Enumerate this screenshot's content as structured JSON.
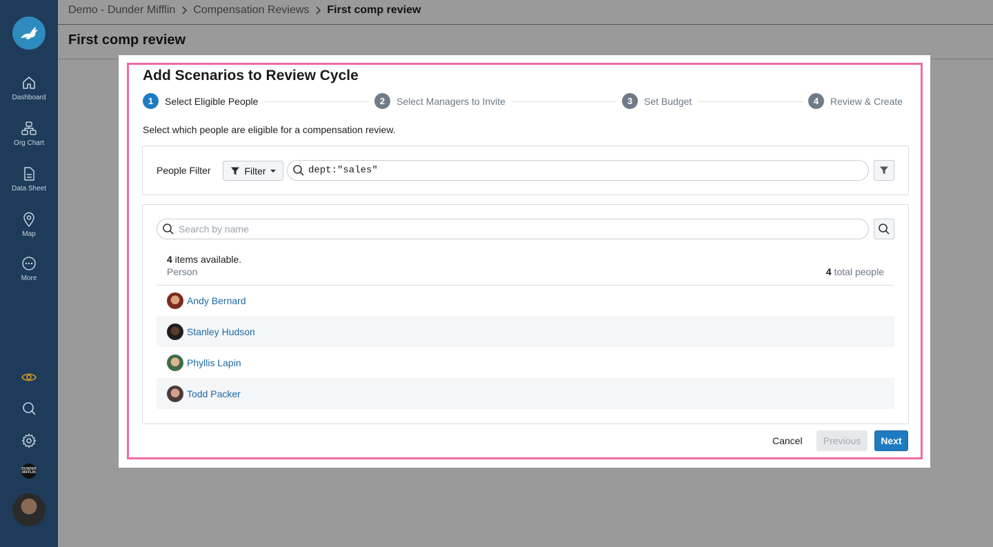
{
  "sidebar": {
    "items": [
      {
        "label": "Dashboard",
        "icon": "home-icon"
      },
      {
        "label": "Org Chart",
        "icon": "org-chart-icon"
      },
      {
        "label": "Data Sheet",
        "icon": "document-icon"
      },
      {
        "label": "Map",
        "icon": "map-pin-icon"
      },
      {
        "label": "More",
        "icon": "more-icon"
      }
    ],
    "bottom_icons": [
      "eye-icon",
      "search-icon",
      "gear-icon"
    ],
    "company_logo_text": "DUNDER MIFFLIN"
  },
  "breadcrumb": {
    "items": [
      "Demo - Dunder Mifflin",
      "Compensation Reviews"
    ],
    "current": "First comp review"
  },
  "page": {
    "title": "First comp review"
  },
  "modal": {
    "title": "Add Scenarios to Review Cycle",
    "steps": [
      {
        "num": "1",
        "label": "Select Eligible People"
      },
      {
        "num": "2",
        "label": "Select Managers to Invite"
      },
      {
        "num": "3",
        "label": "Set Budget"
      },
      {
        "num": "4",
        "label": "Review & Create"
      }
    ],
    "active_step": 1,
    "instructions": "Select which people are eligible for a compensation review.",
    "filter": {
      "label": "People Filter",
      "button_label": "Filter",
      "query": "dept:\"sales\""
    },
    "search": {
      "placeholder": "Search by name"
    },
    "available": {
      "count": "4",
      "suffix": " items available."
    },
    "column_header": "Person",
    "total": {
      "count": "4",
      "suffix": " total people"
    },
    "people": [
      {
        "name": "Andy Bernard"
      },
      {
        "name": "Stanley Hudson"
      },
      {
        "name": "Phyllis Lapin"
      },
      {
        "name": "Todd Packer"
      }
    ],
    "buttons": {
      "cancel": "Cancel",
      "previous": "Previous",
      "next": "Next"
    }
  },
  "colors": {
    "sidebar_bg": "#1e3b5a",
    "accent": "#1f7bc1",
    "highlight_border": "#f06aa8",
    "link": "#1f6aa5",
    "eye_icon": "#d49a1e"
  }
}
